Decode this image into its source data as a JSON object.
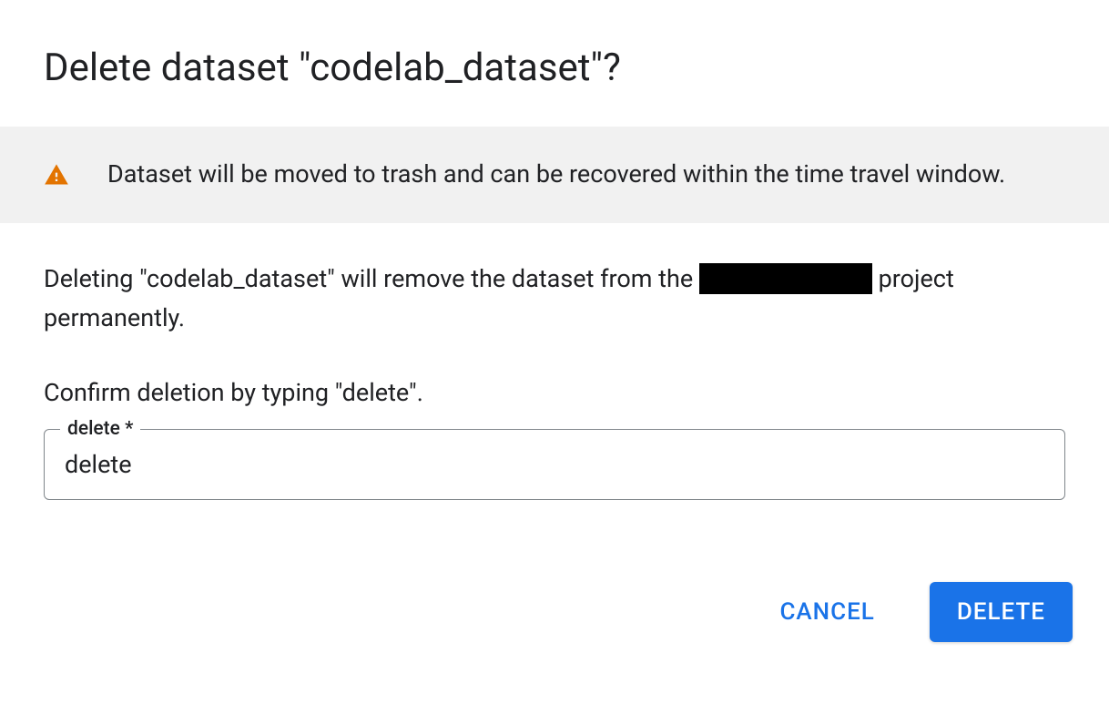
{
  "dialog": {
    "title": "Delete dataset \"codelab_dataset\"?",
    "notice": "Dataset will be moved to trash and can be recovered within the time travel window.",
    "description_prefix": "Deleting \"codelab_dataset\" will remove the dataset from the ",
    "description_suffix": " project permanently.",
    "confirm_instruction": "Confirm deletion by typing \"delete\".",
    "input_label": "delete *",
    "input_value": "delete",
    "cancel_label": "CANCEL",
    "delete_label": "DELETE"
  }
}
